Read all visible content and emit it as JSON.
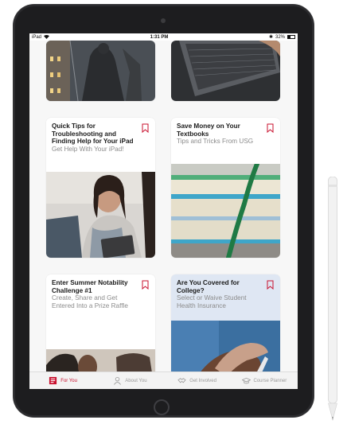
{
  "status_bar": {
    "device": "iPad",
    "time": "1:31 PM",
    "battery": "32%"
  },
  "cards": [
    {
      "title": "Quick Tips for Troubleshooting and Finding Help for Your iPad",
      "subtitle": "Get Help With Your iPad!",
      "image": "student-with-tablet-photo"
    },
    {
      "title": "Save Money on Your Textbooks",
      "subtitle": "Tips and Tricks From USG",
      "image": "stacked-textbooks-photo"
    },
    {
      "title": "Enter Summer Notability Challenge #1",
      "subtitle": "Create, Share and Get Entered Into a Prize Raffle",
      "image": "students-at-desk-photo"
    },
    {
      "title": "Are You Covered for College?",
      "subtitle": "Select or Waive Student Health Insurance",
      "image": "hands-medical-photo"
    }
  ],
  "tabs": [
    {
      "label": "For You",
      "icon": "for-you-icon",
      "active": true
    },
    {
      "label": "About You",
      "icon": "person-icon",
      "active": false
    },
    {
      "label": "Get Involved",
      "icon": "handshake-icon",
      "active": false
    },
    {
      "label": "Course Planner",
      "icon": "graduation-cap-icon",
      "active": false
    }
  ],
  "colors": {
    "accent": "#c8102e",
    "inactive_tab": "#9a9a9a",
    "subtitle": "#8b8b8b"
  }
}
